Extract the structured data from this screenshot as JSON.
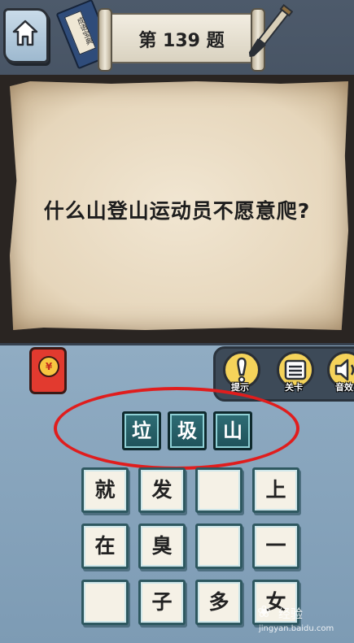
{
  "header": {
    "level_title": "第 139 题",
    "book_label": "成语宝典"
  },
  "question": {
    "text": "什么山登山运动员不愿意爬?"
  },
  "tools": [
    {
      "label": "提示",
      "icon": "hint-icon"
    },
    {
      "label": "关卡",
      "icon": "levels-icon"
    },
    {
      "label": "音效",
      "icon": "sound-icon"
    }
  ],
  "redpacket": {
    "symbol": "¥"
  },
  "answer": [
    "垃",
    "圾",
    "山"
  ],
  "tiles": [
    [
      "就",
      "发",
      "",
      "上"
    ],
    [
      "在",
      "臭",
      "",
      "一"
    ],
    [
      "",
      "子",
      "多",
      "女"
    ]
  ],
  "watermark": {
    "brand": "经验",
    "url": "jingyan.baidu.com"
  },
  "colors": {
    "highlight_ring": "#e01d1d",
    "answer_tile": "#2e6d75",
    "tool_yellow": "#f5d35a"
  }
}
